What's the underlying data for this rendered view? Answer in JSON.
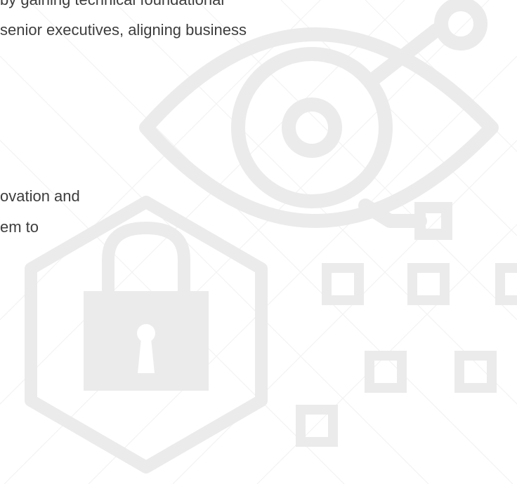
{
  "paragraph_1": {
    "line_1": "by gaining technical foundational",
    "line_2": "senior executives, aligning business"
  },
  "paragraph_2": {
    "line_1": "ovation and",
    "line_2": "em to"
  },
  "colors": {
    "text": "#3d3d3d",
    "icon_stroke": "#ebebeb",
    "grid_lines": "#f3f3f3"
  },
  "icons": [
    "eye-circuit-icon",
    "padlock-hexagon-icon",
    "square-grid-pattern"
  ]
}
